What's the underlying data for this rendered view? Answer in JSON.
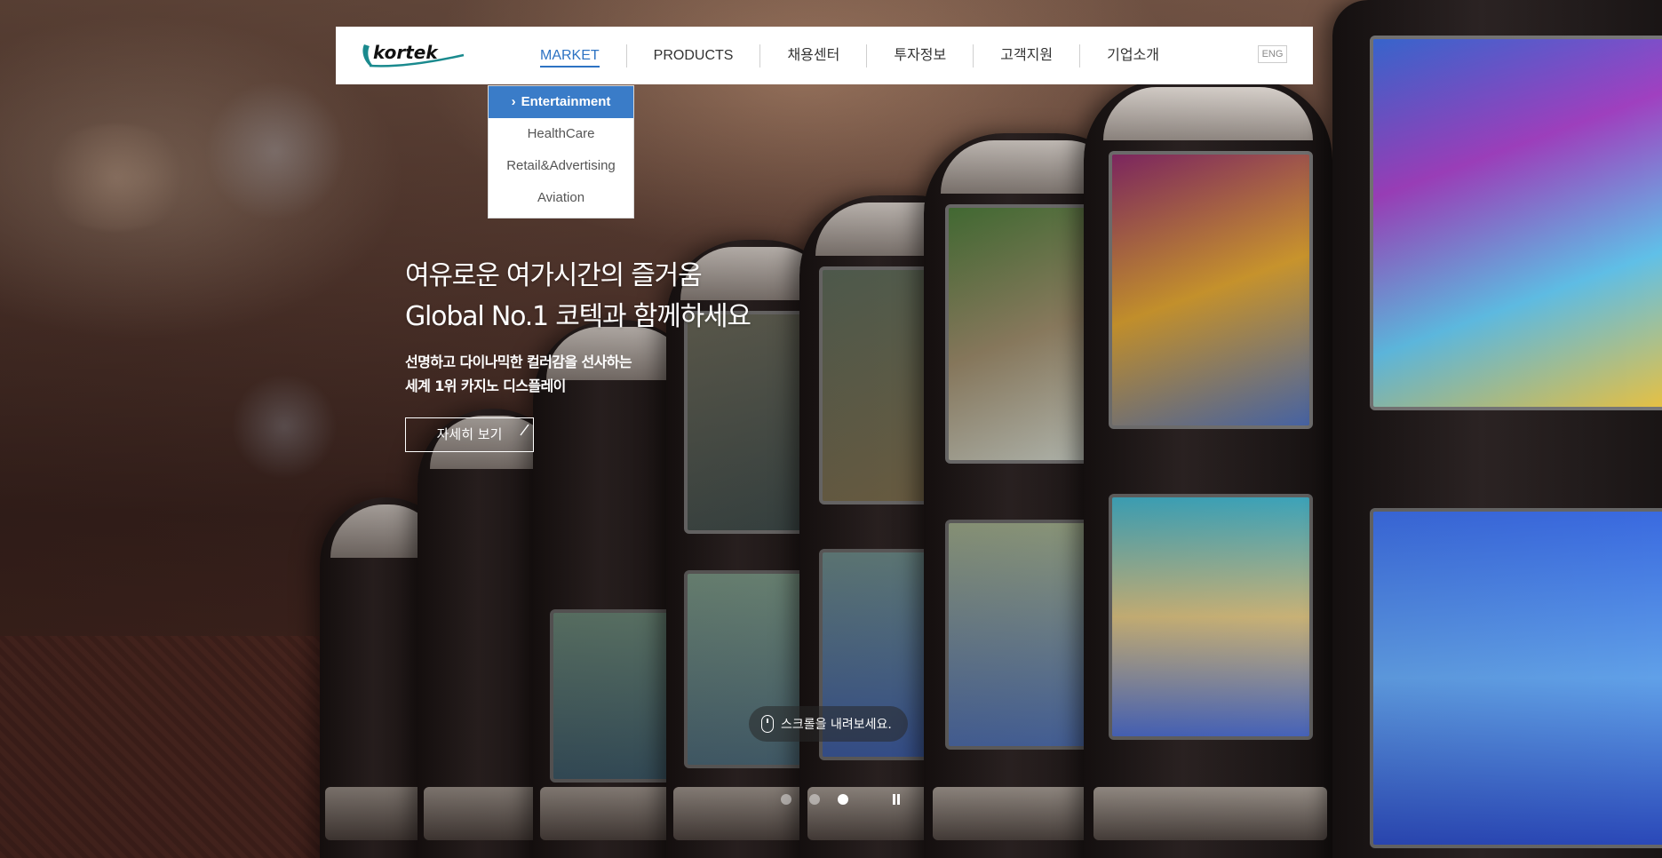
{
  "brand": {
    "logo_text": "kortek",
    "logo_color": "#1a6e74"
  },
  "nav": {
    "items": [
      {
        "label": "MARKET",
        "active": true
      },
      {
        "label": "PRODUCTS"
      },
      {
        "label": "채용센터"
      },
      {
        "label": "투자정보"
      },
      {
        "label": "고객지원"
      },
      {
        "label": "기업소개"
      }
    ],
    "lang_button": "ENG",
    "accent": "#2d73c3"
  },
  "dropdown": {
    "items": [
      {
        "label": "Entertainment",
        "active": true
      },
      {
        "label": "HealthCare"
      },
      {
        "label": "Retail&Advertising"
      },
      {
        "label": "Aviation"
      }
    ]
  },
  "hero": {
    "headline_line1": "여유로운 여가시간의 즐거움",
    "headline_line2": "Global No.1 코텍과 함께하세요",
    "sub_line1": "선명하고 다이나믹한 컬러감을 선사하는",
    "sub_line2": "세계 1위 카지노 디스플레이",
    "more_button": "자세히 보기"
  },
  "scroll_hint": {
    "text": "스크롤을 내려보세요."
  },
  "slider": {
    "count": 3,
    "active_index": 3
  }
}
